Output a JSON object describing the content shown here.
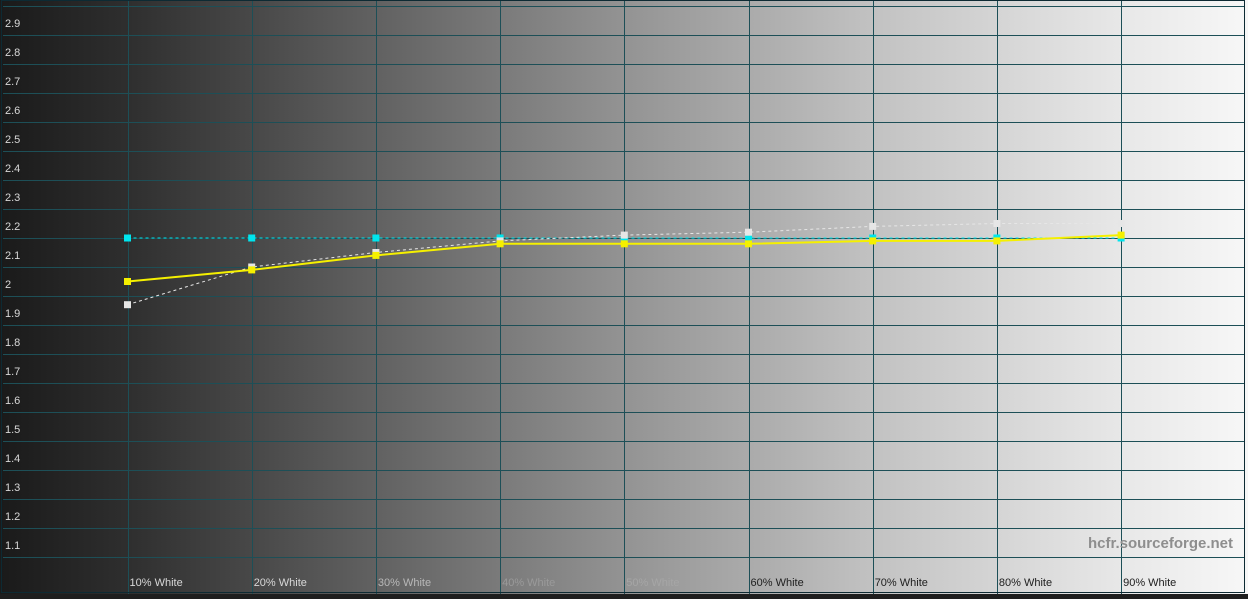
{
  "chart_data": {
    "type": "line",
    "title": "",
    "xlabel": "",
    "ylabel": "",
    "categories": [
      "10% White",
      "20% White",
      "30% White",
      "40% White",
      "50% White",
      "60% White",
      "70% White",
      "80% White",
      "90% White"
    ],
    "y_ticks": [
      "1.1",
      "1.2",
      "1.3",
      "1.4",
      "1.5",
      "1.6",
      "1.7",
      "1.8",
      "1.9",
      "2",
      "2.1",
      "2.2",
      "2.3",
      "2.4",
      "2.5",
      "2.6",
      "2.7",
      "2.8",
      "2.9"
    ],
    "ylim": [
      1.0,
      3.0
    ],
    "grid": true,
    "background": "grayscale gradient (dark to white, left to right)",
    "series": [
      {
        "values": [
          2.2,
          2.2,
          2.2,
          2.2,
          2.2,
          2.2,
          2.2,
          2.2,
          2.2
        ],
        "color": "#00e5ee",
        "style": "dotted",
        "marker": "square"
      },
      {
        "values": [
          1.97,
          2.1,
          2.15,
          2.19,
          2.21,
          2.22,
          2.24,
          2.25,
          2.25
        ],
        "color": "#e6e6e6",
        "style": "dotted",
        "marker": "square"
      },
      {
        "values": [
          2.05,
          2.09,
          2.14,
          2.18,
          2.18,
          2.18,
          2.19,
          2.19,
          2.21
        ],
        "color": "#f5f000",
        "style": "solid",
        "marker": "square"
      }
    ]
  },
  "watermark": "hcfr.sourceforge.net",
  "colors": {
    "grid": "#1d4f57",
    "frame": "#0d2a33",
    "tick_text_dark": "#d8d8d8",
    "tick_text_light": "#202020"
  }
}
